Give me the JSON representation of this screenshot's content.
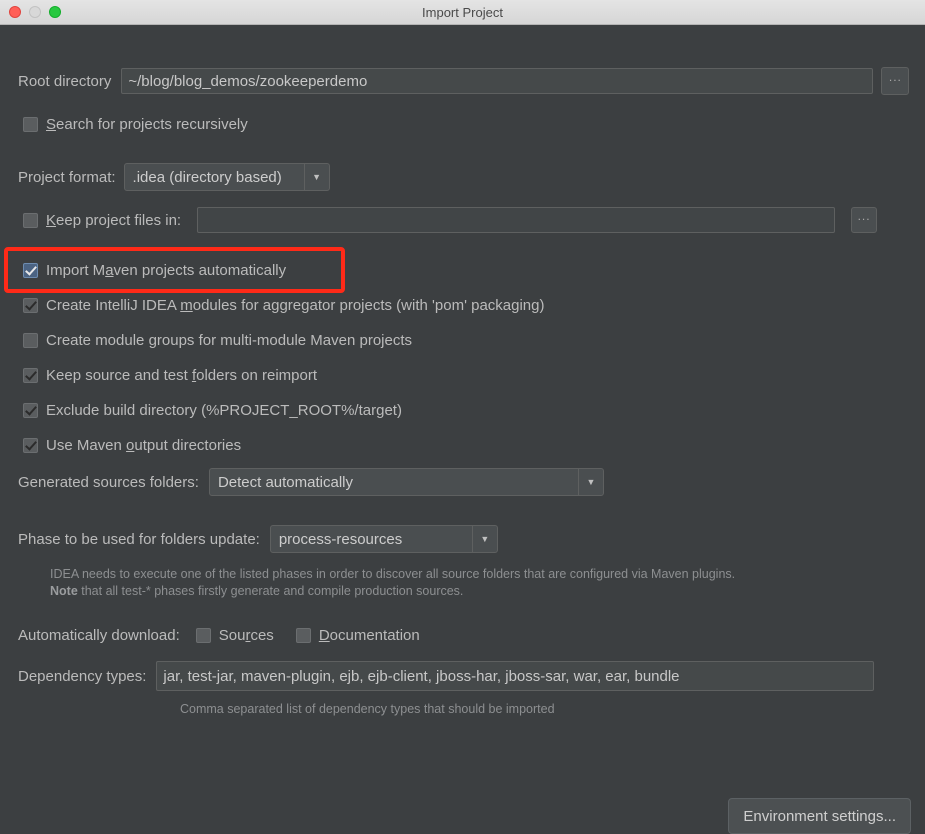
{
  "window": {
    "title": "Import Project",
    "controls": [
      {
        "name": "close",
        "color": "#ff5f57"
      },
      {
        "name": "minimize",
        "color": "#d8d8d8"
      },
      {
        "name": "zoom",
        "color": "#28c840"
      }
    ]
  },
  "root_directory": {
    "label": "Root directory",
    "value": "~/blog/blog_demos/zookeeperdemo",
    "browse_label": "..."
  },
  "search_recursively": {
    "label_pre": "",
    "label_mnemonic": "S",
    "label_post": "earch for projects recursively",
    "checked": false
  },
  "project_format": {
    "label": "Project format:",
    "value": ".idea (directory based)",
    "arrow": "▼"
  },
  "keep_project_files": {
    "label_pre": "",
    "label_mnemonic": "K",
    "label_post": "eep project files in:",
    "checked": false,
    "value": "",
    "browse_label": "..."
  },
  "maven_options": [
    {
      "id": "import-maven-projects-automatically",
      "label_pre": "Import M",
      "label_mnemonic": "a",
      "label_post": "ven projects automatically",
      "checked": true,
      "focused": true,
      "highlighted": true
    },
    {
      "id": "create-intellij-idea-modules",
      "label_pre": "Create IntelliJ IDEA ",
      "label_mnemonic": "m",
      "label_post": "odules for aggregator projects (with 'pom' packaging)",
      "checked": true,
      "focused": false,
      "highlighted": false
    },
    {
      "id": "create-module-groups",
      "label_pre": "Create module ",
      "label_mnemonic": "g",
      "label_post": "roups for multi-module Maven projects",
      "checked": false,
      "focused": false,
      "highlighted": false
    },
    {
      "id": "keep-source-and-test-folders",
      "label_pre": "Keep source and test ",
      "label_mnemonic": "f",
      "label_post": "olders on reimport",
      "checked": true,
      "focused": false,
      "highlighted": false
    },
    {
      "id": "exclude-build-directory",
      "label_pre": "Exclude build directory (%PROJECT_ROOT%/target)",
      "label_mnemonic": "",
      "label_post": "",
      "checked": true,
      "focused": false,
      "highlighted": false
    },
    {
      "id": "use-maven-output-directories",
      "label_pre": "Use Maven ",
      "label_mnemonic": "o",
      "label_post": "utput directories",
      "checked": true,
      "focused": false,
      "highlighted": false
    }
  ],
  "generated_sources": {
    "label": "Generated sources folders:",
    "value": "Detect automatically",
    "arrow": "▼"
  },
  "phase_update": {
    "label": "Phase to be used for folders update:",
    "value": "process-resources",
    "arrow": "▼"
  },
  "phase_hint": {
    "line1": "IDEA needs to execute one of the listed phases in order to discover all source folders that are configured via Maven plugins.",
    "line2_bold": "Note",
    "line2_rest": " that all test-* phases firstly generate and compile production sources."
  },
  "auto_download": {
    "label": "Automatically download:",
    "sources": {
      "label_pre": "Sou",
      "label_mnemonic": "r",
      "label_post": "ces",
      "checked": false
    },
    "documentation": {
      "label_pre": "",
      "label_mnemonic": "D",
      "label_post": "ocumentation",
      "checked": false
    }
  },
  "dependency_types": {
    "label": "Dependency types:",
    "value": "jar, test-jar, maven-plugin, ejb, ejb-client, jboss-har, jboss-sar, war, ear, bundle",
    "hint": "Comma separated list of dependency types that should be imported"
  },
  "environment_settings": {
    "label": "Environment settings..."
  },
  "colors": {
    "background": "#3c3f41",
    "titlebar": "#dcdcdc",
    "highlight": "#ff2a18",
    "text": "#bbbbbb",
    "hint_text": "#8d8f91"
  }
}
